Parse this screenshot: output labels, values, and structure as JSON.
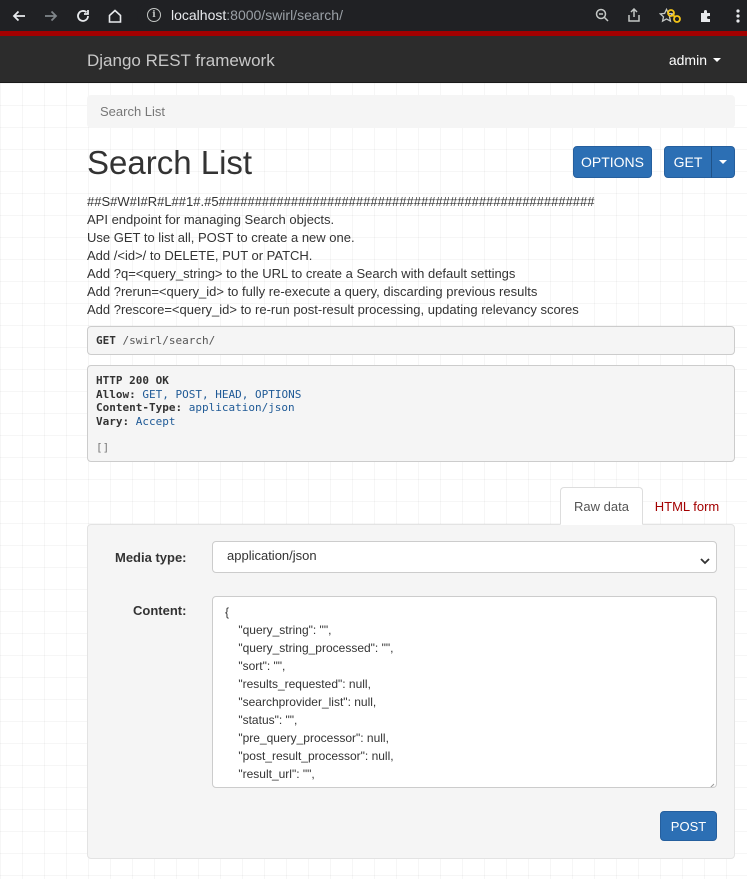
{
  "browser": {
    "url_host": "localhost",
    "url_rest": ":8000/swirl/search/"
  },
  "navbar": {
    "brand": "Django REST framework",
    "user": "admin"
  },
  "breadcrumb": {
    "label": "Search List"
  },
  "header": {
    "title": "Search List",
    "options_label": "OPTIONS",
    "get_label": "GET"
  },
  "description": [
    "##S#W#I#R#L##1#.#5####################################################",
    "API endpoint for managing Search objects.",
    "Use GET to list all, POST to create a new one.",
    "Add /<id>/ to DELETE, PUT or PATCH.",
    "Add ?q=<query_string> to the URL to create a Search with default settings",
    "Add ?rerun=<query_id> to fully re-execute a query, discarding previous results",
    "Add ?rescore=<query_id> to re-run post-result processing, updating relevancy scores"
  ],
  "request": {
    "method": "GET",
    "path": "/swirl/search/"
  },
  "response": {
    "status": "HTTP 200 OK",
    "headers": [
      {
        "name": "Allow:",
        "value": "GET, POST, HEAD, OPTIONS"
      },
      {
        "name": "Content-Type:",
        "value": "application/json"
      },
      {
        "name": "Vary:",
        "value": "Accept"
      }
    ],
    "body": "[]"
  },
  "tabs": {
    "raw": "Raw data",
    "html": "HTML form"
  },
  "form": {
    "media_type_label": "Media type:",
    "media_type_value": "application/json",
    "content_label": "Content:",
    "content_lines": [
      "{",
      "    \"query_string\": \"\",",
      "    \"query_string_processed\": \"\",",
      "    \"sort\": \"\",",
      "    \"results_requested\": null,",
      "    \"searchprovider_list\": null,",
      "    \"status\": \"\",",
      "    \"pre_query_processor\": null,",
      "    \"post_result_processor\": null,",
      "    \"result_url\": \"\","
    ],
    "post_label": "POST"
  },
  "colors": {
    "accent_red": "#a30000",
    "button_blue": "#2c6fb4",
    "navbar": "#2c2c2c"
  },
  "icons": [
    "back-arrow-icon",
    "forward-arrow-icon",
    "reload-icon",
    "home-icon",
    "info-icon",
    "zoom-icon",
    "share-icon",
    "star-icon",
    "extension-key-icon",
    "puzzle-icon",
    "kebab-menu-icon"
  ]
}
